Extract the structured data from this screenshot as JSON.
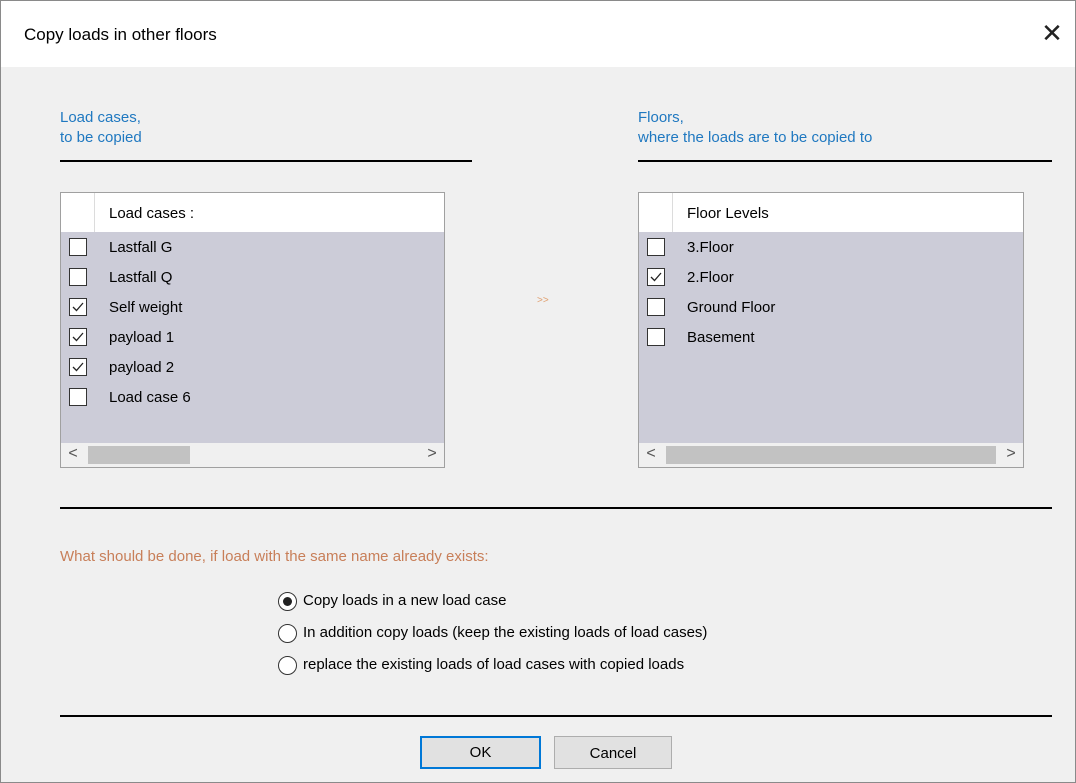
{
  "dialog": {
    "title": "Copy loads in other floors",
    "close_glyph": "✕"
  },
  "left_panel": {
    "caption_line1": "Load cases,",
    "caption_line2": "to be copied",
    "header": "Load cases :",
    "items": [
      {
        "label": "Lastfall G",
        "checked": false
      },
      {
        "label": "Lastfall Q",
        "checked": false
      },
      {
        "label": "Self weight",
        "checked": true
      },
      {
        "label": "payload 1",
        "checked": true
      },
      {
        "label": "payload 2",
        "checked": true
      },
      {
        "label": "Load case 6",
        "checked": false
      }
    ]
  },
  "right_panel": {
    "caption_line1": "Floors,",
    "caption_line2": "where the loads are to be copied to",
    "header": "Floor Levels",
    "items": [
      {
        "label": "3.Floor",
        "checked": false
      },
      {
        "label": "2.Floor",
        "checked": true
      },
      {
        "label": "Ground Floor",
        "checked": false
      },
      {
        "label": "Basement",
        "checked": false
      }
    ]
  },
  "arrow_text": ">>",
  "scroll": {
    "left": "<",
    "right": ">"
  },
  "question": "What should be done, if load with the same name already exists:",
  "options": [
    {
      "label": "Copy loads in a new load case",
      "selected": true
    },
    {
      "label": "In addition copy loads (keep the existing loads of load cases)",
      "selected": false
    },
    {
      "label": "replace the existing loads of load cases with copied loads",
      "selected": false
    }
  ],
  "buttons": {
    "ok": "OK",
    "cancel": "Cancel"
  },
  "colors": {
    "caption_blue": "#1f78c0",
    "question_orange": "#c87f59",
    "list_background": "#ccccd8",
    "default_button_border": "#0078d7"
  }
}
